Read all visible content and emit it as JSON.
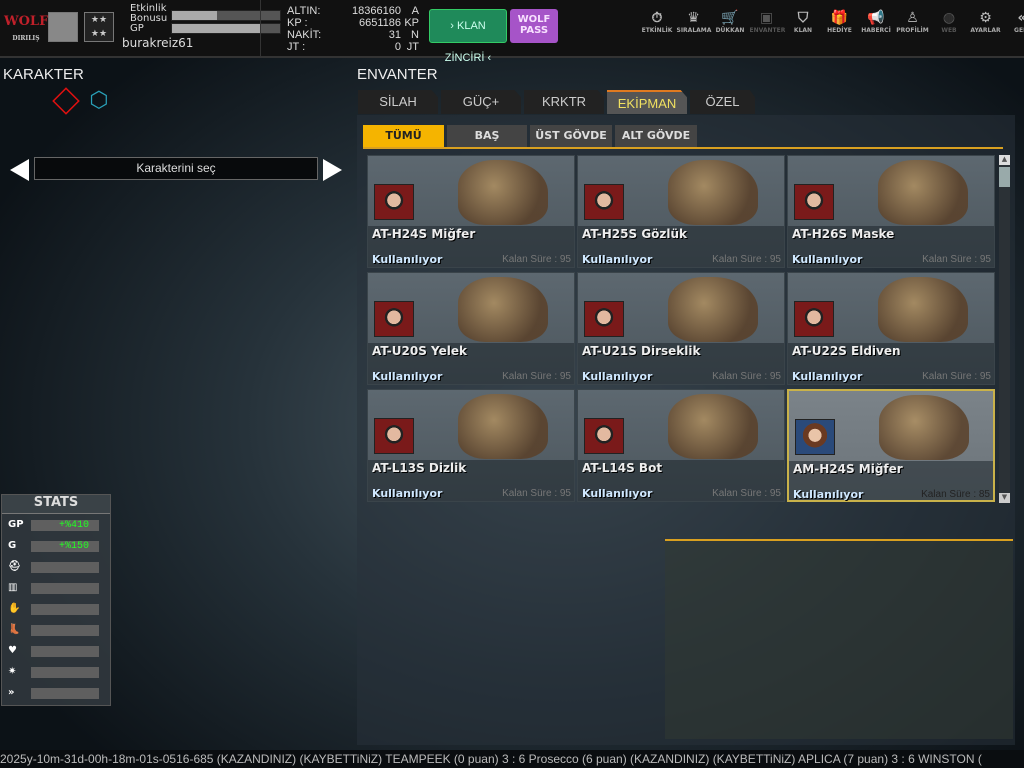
{
  "top": {
    "logo": "WOLF",
    "logo_sub": "DIRILIŞ",
    "event_bonus_label": "Etkinlik Bonusu",
    "event_bonus_fill": 0.42,
    "gp_label": "GP",
    "gp_fill": 0.82,
    "username": "burakreiz61",
    "currencies": [
      {
        "label": "ALTIN:",
        "value": "18366160",
        "unit": "A"
      },
      {
        "label": "KP  :",
        "value": "6651186",
        "unit": "KP"
      },
      {
        "label": "NAKİT:",
        "value": "31",
        "unit": "N"
      },
      {
        "label": "JT  :",
        "value": "0",
        "unit": "JT"
      }
    ],
    "klan_button": "› KLAN ZİNCİRİ ‹",
    "wolf_pass_button": "WOLF PASS"
  },
  "nav": [
    {
      "label": "ETKİNLİK",
      "icon": "⏱"
    },
    {
      "label": "SIRALAMA",
      "icon": "♛"
    },
    {
      "label": "DÜKKAN",
      "icon": "🛒"
    },
    {
      "label": "ENVANTER",
      "icon": "▣"
    },
    {
      "label": "KLAN",
      "icon": "⛉"
    },
    {
      "label": "HEDİYE",
      "icon": "🎁"
    },
    {
      "label": "HABERCİ",
      "icon": "📢"
    },
    {
      "label": "PROFİLİM",
      "icon": "♙"
    },
    {
      "label": "WEB",
      "icon": "◍"
    },
    {
      "label": "AYARLAR",
      "icon": "⚙"
    },
    {
      "label": "GERİ",
      "icon": "«"
    }
  ],
  "left": {
    "title": "KARAKTER",
    "char_select": "Karakterini seç"
  },
  "stats": {
    "title": "STATS",
    "rows": [
      {
        "icon": "GP",
        "value": "+%410"
      },
      {
        "icon": "G",
        "value": "+%150"
      },
      {
        "icon": "⛑",
        "value": ""
      },
      {
        "icon": "▥",
        "value": ""
      },
      {
        "icon": "✋",
        "value": ""
      },
      {
        "icon": "👢",
        "value": ""
      },
      {
        "icon": "♥",
        "value": ""
      },
      {
        "icon": "✷",
        "value": ""
      },
      {
        "icon": "»",
        "value": ""
      }
    ]
  },
  "inventory": {
    "title": "ENVANTER",
    "tabs": [
      "SİLAH",
      "GÜÇ+",
      "KRKTR",
      "EKİPMAN",
      "ÖZEL"
    ],
    "active_tab": 3,
    "subtabs": [
      "TÜMÜ",
      "BAŞ",
      "ÜST GÖVDE",
      "ALT GÖVDE"
    ],
    "active_subtab": 0,
    "items": [
      {
        "name": "AT-H24S Miğfer",
        "status": "Kullanılıyor",
        "time": "Kalan Süre : 95"
      },
      {
        "name": "AT-H25S Gözlük",
        "status": "Kullanılıyor",
        "time": "Kalan Süre : 95"
      },
      {
        "name": "AT-H26S Maske",
        "status": "Kullanılıyor",
        "time": "Kalan Süre : 95"
      },
      {
        "name": "AT-U20S Yelek",
        "status": "Kullanılıyor",
        "time": "Kalan Süre : 95"
      },
      {
        "name": "AT-U21S Dirseklik",
        "status": "Kullanılıyor",
        "time": "Kalan Süre : 95"
      },
      {
        "name": "AT-U22S Eldiven",
        "status": "Kullanılıyor",
        "time": "Kalan Süre : 95"
      },
      {
        "name": "AT-L13S Dizlik",
        "status": "Kullanılıyor",
        "time": "Kalan Süre : 95"
      },
      {
        "name": "AT-L14S Bot",
        "status": "Kullanılıyor",
        "time": "Kalan Süre : 95"
      },
      {
        "name": "AM-H24S Miğfer",
        "status": "Kullanılıyor",
        "time": "Kalan Süre : 85"
      }
    ]
  },
  "ticker": "2025y-10m-31d-00h-18m-01s-0516-685  (KAZANDINIZ)   (KAYBETTiNiZ) TEAMPEEK (0 puan) 3 : 6 Prosecco (6 puan) (KAZANDINIZ)          (KAYBETTiNiZ) APLICA (7 puan) 3 : 6 WINSTON ("
}
